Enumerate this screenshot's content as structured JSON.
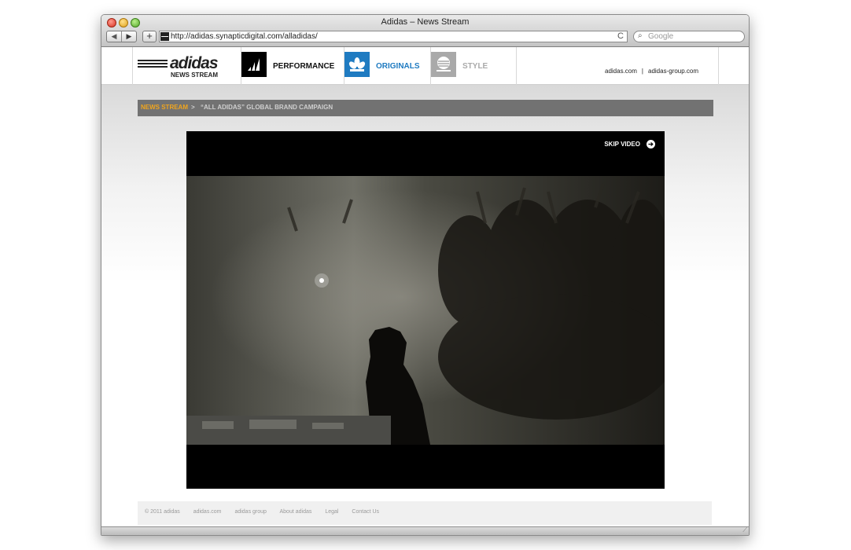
{
  "window": {
    "title": "Adidas – News Stream"
  },
  "browser": {
    "back_label": "◀",
    "forward_label": "▶",
    "add_label": "+",
    "url": "http://adidas.synapticdigital.com/alladidas/",
    "reload_label": "C",
    "search_placeholder": "Google"
  },
  "header": {
    "logo_text": "adidas",
    "logo_subtitle": "NEWS STREAM",
    "brands": [
      {
        "label": "PERFORMANCE",
        "color": "#111111"
      },
      {
        "label": "ORIGINALS",
        "color": "#1f7bc1"
      },
      {
        "label": "STYLE",
        "color": "#aaaaaa"
      }
    ],
    "links": [
      "adidas.com",
      "adidas-group.com"
    ],
    "links_separator": "|"
  },
  "breadcrumb": {
    "home": "NEWS STREAM",
    "separator": ">",
    "current": "“ALL ADIDAS” GLOBAL BRAND CAMPAIGN",
    "home_color": "#f0a51e"
  },
  "player": {
    "skip_label": "SKIP VIDEO"
  },
  "footer": {
    "links": [
      "© 2011 adidas",
      "adidas.com",
      "adidas group",
      "About adidas",
      "Legal",
      "Contact Us"
    ]
  }
}
